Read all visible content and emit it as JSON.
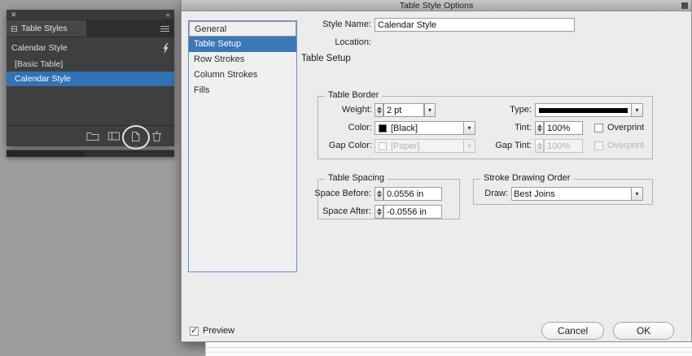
{
  "colors": {
    "accent_blue": "#3a78b8",
    "panel_selected_blue": "#3173b5"
  },
  "panel": {
    "close_icon": "✕",
    "collapse_icon": "«",
    "tab_title": "Table Styles",
    "current_style": "Calendar Style",
    "styles": [
      "[Basic Table]",
      "Calendar Style"
    ],
    "selected_style": "Calendar Style"
  },
  "dialog": {
    "title": "Table Style Options",
    "sidebar": [
      "General",
      "Table Setup",
      "Row Strokes",
      "Column Strokes",
      "Fills"
    ],
    "selected_tab": "Table Setup",
    "style_name_label": "Style Name:",
    "style_name_value": "Calendar Style",
    "location_label": "Location:",
    "section_heading": "Table Setup",
    "table_border": {
      "legend": "Table Border",
      "weight_label": "Weight:",
      "weight_value": "2 pt",
      "type_label": "Type:",
      "color_label": "Color:",
      "color_value": "[Black]",
      "color_swatch": "#000000",
      "tint_label": "Tint:",
      "tint_value": "100%",
      "overprint_label": "Overprint",
      "gap_color_label": "Gap Color:",
      "gap_color_value": "[Paper]",
      "gap_tint_label": "Gap Tint:",
      "gap_tint_value": "100%",
      "gap_overprint_label": "Overprint"
    },
    "table_spacing": {
      "legend": "Table Spacing",
      "space_before_label": "Space Before:",
      "space_before_value": "0.0556 in",
      "space_after_label": "Space After:",
      "space_after_value": "-0.0556 in"
    },
    "stroke_order": {
      "legend": "Stroke Drawing Order",
      "draw_label": "Draw:",
      "draw_value": "Best Joins"
    },
    "preview_label": "Preview",
    "preview_checked": true,
    "cancel_label": "Cancel",
    "ok_label": "OK"
  }
}
